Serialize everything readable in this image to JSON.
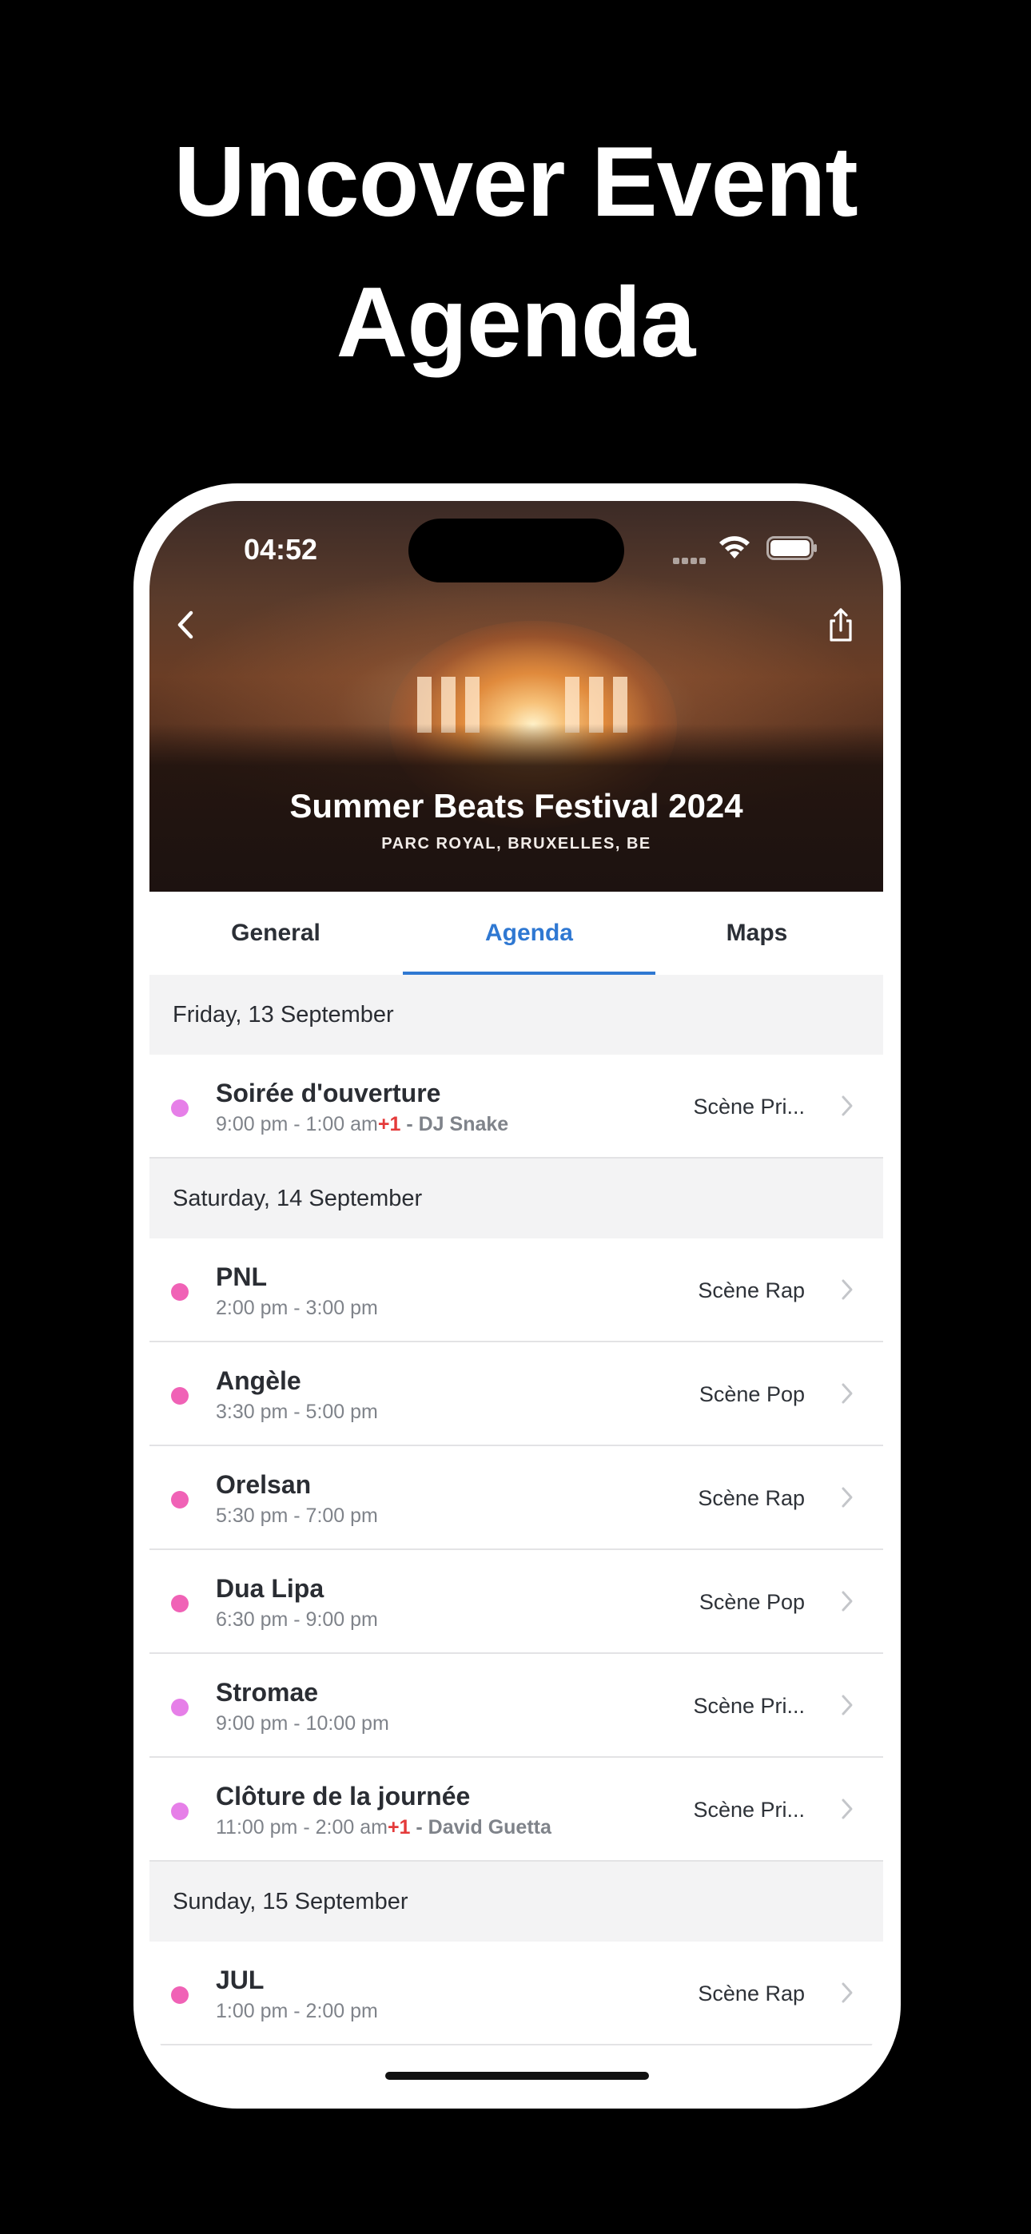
{
  "headline": {
    "line1": "Uncover Event",
    "line2": "Agenda"
  },
  "status_bar": {
    "time": "04:52"
  },
  "event": {
    "title": "Summer Beats Festival 2024",
    "location": "PARC ROYAL, BRUXELLES, BE"
  },
  "tabs": [
    {
      "label": "General",
      "active": false
    },
    {
      "label": "Agenda",
      "active": true
    },
    {
      "label": "Maps",
      "active": false
    }
  ],
  "colors": {
    "accent": "#2f78d2",
    "dot_pink": "#f062b6",
    "dot_violet": "#e67fe8",
    "plus_red": "#e43a3a"
  },
  "days": [
    {
      "label": "Friday, 13 September",
      "items": [
        {
          "title": "Soirée d'ouverture",
          "time": "9:00 pm - 1:00 am",
          "plus": "+1",
          "sep": " - ",
          "artist": "DJ Snake",
          "stage": "Scène Pri...",
          "dot": "#e67fe8"
        }
      ]
    },
    {
      "label": "Saturday, 14 September",
      "items": [
        {
          "title": "PNL",
          "time": "2:00 pm - 3:00 pm",
          "stage": "Scène Rap",
          "dot": "#f062b6"
        },
        {
          "title": "Angèle",
          "time": "3:30 pm - 5:00 pm",
          "stage": "Scène Pop",
          "dot": "#f062b6"
        },
        {
          "title": "Orelsan",
          "time": "5:30 pm - 7:00 pm",
          "stage": "Scène Rap",
          "dot": "#f062b6"
        },
        {
          "title": "Dua Lipa",
          "time": "6:30 pm - 9:00 pm",
          "stage": "Scène Pop",
          "dot": "#f062b6"
        },
        {
          "title": "Stromae",
          "time": "9:00 pm - 10:00 pm",
          "stage": "Scène Pri...",
          "dot": "#e67fe8"
        },
        {
          "title": "Clôture de la journée",
          "time": "11:00 pm - 2:00 am",
          "plus": "+1",
          "sep": " - ",
          "artist": "David Guetta",
          "stage": "Scène Pri...",
          "dot": "#e67fe8"
        }
      ]
    },
    {
      "label": "Sunday, 15 September",
      "items": [
        {
          "title": "JUL",
          "time": "1:00 pm - 2:00 pm",
          "stage": "Scène Rap",
          "dot": "#f062b6"
        }
      ]
    }
  ]
}
